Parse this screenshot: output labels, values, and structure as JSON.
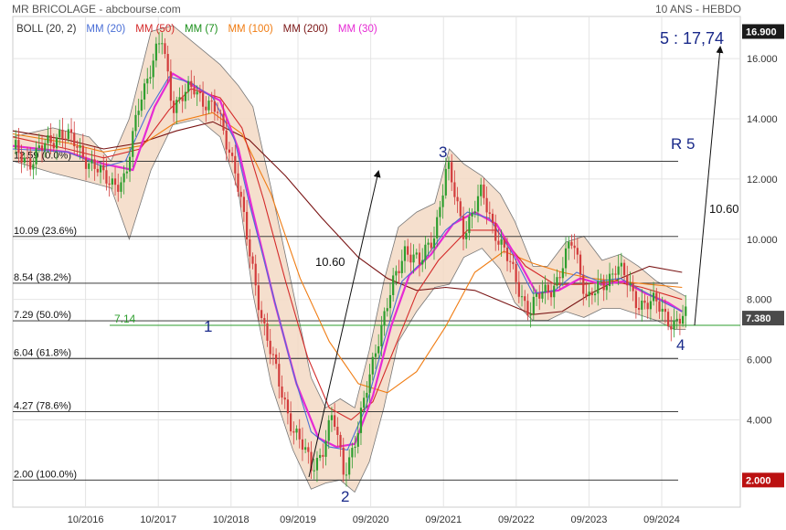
{
  "header": {
    "title": "MR BRICOLAGE - abcbourse.com",
    "timeframe": "10 ANS - HEBDO"
  },
  "legend": [
    {
      "label": "BOLL (20, 2)",
      "color": "#333333"
    },
    {
      "label": "MM (20)",
      "color": "#4a6fd6"
    },
    {
      "label": "MM (50)",
      "color": "#d42a2a"
    },
    {
      "label": "MM (7)",
      "color": "#1a8f1a"
    },
    {
      "label": "MM (100)",
      "color": "#f07c12"
    },
    {
      "label": "MM (200)",
      "color": "#7a1515"
    },
    {
      "label": "MM (30)",
      "color": "#e62ad4"
    }
  ],
  "colors": {
    "up": "#2e9e2e",
    "down": "#d23c3c",
    "band_fill": "#f3d9c4",
    "band_line": "#777777",
    "grid": "#e4e4e4",
    "annotation": "#1a2a8a",
    "hline": "#222222",
    "last_price_bg": "#4a4a4a",
    "target_bg": "#1a1a1a",
    "low_bg": "#bb1111",
    "support": "#2e9e2e"
  },
  "annotations": {
    "target_label": "5 : 17,74",
    "r5": "R 5",
    "measure_left": "10.60",
    "measure_right": "10.60",
    "wave1": "1",
    "wave2": "2",
    "wave3": "3",
    "wave4": "4",
    "support_label": "7.14"
  },
  "price_tags": {
    "target": "16.900",
    "last": "7.380",
    "low": "2.000"
  },
  "chart_data": {
    "type": "candlestick",
    "title": "MR BRICOLAGE - abcbourse.com",
    "subtitle": "10 ANS - HEBDO",
    "x_ticks": [
      {
        "label": "10/2016",
        "t": 2016.75
      },
      {
        "label": "10/2017",
        "t": 2017.75
      },
      {
        "label": "10/2018",
        "t": 2018.75
      },
      {
        "label": "09/2019",
        "t": 2019.67
      },
      {
        "label": "09/2020",
        "t": 2020.67
      },
      {
        "label": "09/2021",
        "t": 2021.67
      },
      {
        "label": "09/2022",
        "t": 2022.67
      },
      {
        "label": "09/2023",
        "t": 2023.67
      },
      {
        "label": "09/2024",
        "t": 2024.67
      }
    ],
    "xlim": [
      2015.75,
      2025.75
    ],
    "y_ticks": [
      4,
      6,
      8,
      10,
      12,
      14,
      16
    ],
    "ylim": [
      1.1,
      17.4
    ],
    "grid": true,
    "fibonacci_levels": [
      {
        "value": 12.59,
        "label": "12.59 (0.0%)"
      },
      {
        "value": 10.09,
        "label": "10.09 (23.6%)"
      },
      {
        "value": 8.54,
        "label": "8.54 (38.2%)"
      },
      {
        "value": 7.29,
        "label": "7.29 (50.0%)"
      },
      {
        "value": 6.04,
        "label": "6.04 (61.8%)"
      },
      {
        "value": 4.27,
        "label": "4.27 (78.6%)"
      },
      {
        "value": 2.0,
        "label": "2.00 (100.0%)"
      }
    ],
    "support_level": 7.14,
    "last_price": 7.38,
    "target_price": 16.9,
    "low_price": 2.0,
    "price_path": [
      [
        2015.75,
        13.0
      ],
      [
        2016.0,
        12.6
      ],
      [
        2016.4,
        13.6
      ],
      [
        2016.7,
        12.9
      ],
      [
        2017.0,
        12.0
      ],
      [
        2017.3,
        11.9
      ],
      [
        2017.5,
        14.8
      ],
      [
        2017.8,
        16.6
      ],
      [
        2017.95,
        14.5
      ],
      [
        2018.25,
        15.0
      ],
      [
        2018.55,
        14.2
      ],
      [
        2018.8,
        12.5
      ],
      [
        2019.0,
        9.5
      ],
      [
        2019.2,
        7.2
      ],
      [
        2019.4,
        5.2
      ],
      [
        2019.6,
        3.8
      ],
      [
        2019.85,
        2.4
      ],
      [
        2020.0,
        3.0
      ],
      [
        2020.15,
        4.1
      ],
      [
        2020.3,
        2.3
      ],
      [
        2020.5,
        3.6
      ],
      [
        2020.75,
        6.6
      ],
      [
        2020.95,
        8.2
      ],
      [
        2021.15,
        9.8
      ],
      [
        2021.35,
        9.1
      ],
      [
        2021.55,
        10.3
      ],
      [
        2021.72,
        12.4
      ],
      [
        2021.95,
        10.3
      ],
      [
        2022.2,
        11.5
      ],
      [
        2022.4,
        10.2
      ],
      [
        2022.6,
        9.0
      ],
      [
        2022.85,
        7.6
      ],
      [
        2023.0,
        8.1
      ],
      [
        2023.25,
        8.7
      ],
      [
        2023.45,
        10.0
      ],
      [
        2023.65,
        8.0
      ],
      [
        2023.85,
        8.4
      ],
      [
        2024.05,
        9.2
      ],
      [
        2024.3,
        8.0
      ],
      [
        2024.6,
        7.8
      ],
      [
        2024.85,
        7.2
      ],
      [
        2025.0,
        7.38
      ]
    ],
    "moving_averages": [
      {
        "name": "MM (20)",
        "color": "#4a6fd6",
        "path": [
          [
            2015.75,
            13.0
          ],
          [
            2016.5,
            12.9
          ],
          [
            2017.0,
            12.4
          ],
          [
            2017.3,
            12.6
          ],
          [
            2017.6,
            14.2
          ],
          [
            2017.9,
            15.4
          ],
          [
            2018.2,
            15.2
          ],
          [
            2018.5,
            14.7
          ],
          [
            2018.8,
            13.3
          ],
          [
            2019.0,
            11.2
          ],
          [
            2019.3,
            8.4
          ],
          [
            2019.6,
            5.6
          ],
          [
            2019.85,
            3.6
          ],
          [
            2020.1,
            3.1
          ],
          [
            2020.35,
            3.0
          ],
          [
            2020.6,
            4.4
          ],
          [
            2020.85,
            6.6
          ],
          [
            2021.1,
            8.6
          ],
          [
            2021.4,
            9.3
          ],
          [
            2021.7,
            10.3
          ],
          [
            2022.0,
            10.9
          ],
          [
            2022.3,
            10.7
          ],
          [
            2022.6,
            9.6
          ],
          [
            2022.9,
            8.2
          ],
          [
            2023.2,
            8.3
          ],
          [
            2023.5,
            8.9
          ],
          [
            2023.8,
            8.6
          ],
          [
            2024.1,
            8.7
          ],
          [
            2024.4,
            8.3
          ],
          [
            2024.7,
            7.9
          ],
          [
            2024.95,
            7.6
          ]
        ]
      },
      {
        "name": "MM (30)",
        "color": "#e62ad4",
        "path": [
          [
            2015.75,
            13.1
          ],
          [
            2016.5,
            12.9
          ],
          [
            2017.0,
            12.5
          ],
          [
            2017.4,
            12.3
          ],
          [
            2017.7,
            14.4
          ],
          [
            2017.95,
            15.5
          ],
          [
            2018.3,
            15.0
          ],
          [
            2018.6,
            14.6
          ],
          [
            2018.85,
            13.0
          ],
          [
            2019.05,
            10.9
          ],
          [
            2019.35,
            7.9
          ],
          [
            2019.65,
            5.2
          ],
          [
            2019.95,
            3.4
          ],
          [
            2020.2,
            3.1
          ],
          [
            2020.45,
            3.2
          ],
          [
            2020.7,
            4.8
          ],
          [
            2020.95,
            7.1
          ],
          [
            2021.2,
            8.8
          ],
          [
            2021.5,
            9.5
          ],
          [
            2021.8,
            10.5
          ],
          [
            2022.1,
            10.9
          ],
          [
            2022.4,
            10.5
          ],
          [
            2022.7,
            9.3
          ],
          [
            2022.95,
            8.2
          ],
          [
            2023.25,
            8.3
          ],
          [
            2023.55,
            8.7
          ],
          [
            2023.85,
            8.5
          ],
          [
            2024.15,
            8.6
          ],
          [
            2024.45,
            8.2
          ],
          [
            2024.75,
            7.9
          ],
          [
            2024.95,
            7.6
          ]
        ]
      },
      {
        "name": "MM (50)",
        "color": "#d42a2a",
        "path": [
          [
            2015.75,
            13.4
          ],
          [
            2016.5,
            13.0
          ],
          [
            2017.0,
            12.7
          ],
          [
            2017.5,
            13.0
          ],
          [
            2017.9,
            14.3
          ],
          [
            2018.2,
            15.0
          ],
          [
            2018.6,
            14.7
          ],
          [
            2018.9,
            13.7
          ],
          [
            2019.2,
            11.3
          ],
          [
            2019.5,
            8.6
          ],
          [
            2019.8,
            6.1
          ],
          [
            2020.1,
            4.4
          ],
          [
            2020.4,
            4.0
          ],
          [
            2020.7,
            4.6
          ],
          [
            2021.0,
            6.4
          ],
          [
            2021.3,
            8.2
          ],
          [
            2021.6,
            9.3
          ],
          [
            2022.0,
            10.3
          ],
          [
            2022.4,
            10.3
          ],
          [
            2022.8,
            9.1
          ],
          [
            2023.2,
            8.5
          ],
          [
            2023.6,
            8.5
          ],
          [
            2024.0,
            8.6
          ],
          [
            2024.4,
            8.4
          ],
          [
            2024.95,
            8.0
          ]
        ]
      },
      {
        "name": "MM (100)",
        "color": "#f07c12",
        "path": [
          [
            2015.75,
            13.5
          ],
          [
            2016.5,
            13.2
          ],
          [
            2017.0,
            12.9
          ],
          [
            2017.5,
            13.1
          ],
          [
            2018.0,
            13.9
          ],
          [
            2018.5,
            14.2
          ],
          [
            2018.9,
            13.5
          ],
          [
            2019.3,
            11.5
          ],
          [
            2019.7,
            8.7
          ],
          [
            2020.1,
            6.6
          ],
          [
            2020.5,
            5.2
          ],
          [
            2020.9,
            4.9
          ],
          [
            2021.3,
            5.6
          ],
          [
            2021.7,
            7.1
          ],
          [
            2022.1,
            8.9
          ],
          [
            2022.5,
            9.6
          ],
          [
            2022.9,
            9.2
          ],
          [
            2023.3,
            8.9
          ],
          [
            2023.7,
            8.7
          ],
          [
            2024.1,
            8.6
          ],
          [
            2024.5,
            8.5
          ],
          [
            2024.95,
            8.4
          ]
        ]
      },
      {
        "name": "MM (200)",
        "color": "#7a1515",
        "path": [
          [
            2015.75,
            13.6
          ],
          [
            2016.5,
            13.3
          ],
          [
            2017.0,
            13.0
          ],
          [
            2017.5,
            13.2
          ],
          [
            2018.0,
            13.6
          ],
          [
            2018.5,
            13.9
          ],
          [
            2019.0,
            13.3
          ],
          [
            2019.5,
            12.1
          ],
          [
            2020.0,
            10.7
          ],
          [
            2020.5,
            9.4
          ],
          [
            2020.9,
            8.7
          ],
          [
            2021.3,
            8.3
          ],
          [
            2021.7,
            8.4
          ],
          [
            2022.1,
            8.3
          ],
          [
            2022.5,
            7.9
          ],
          [
            2022.9,
            7.5
          ],
          [
            2023.3,
            7.6
          ],
          [
            2023.7,
            8.2
          ],
          [
            2024.1,
            8.7
          ],
          [
            2024.5,
            9.1
          ],
          [
            2024.95,
            8.9
          ]
        ]
      }
    ],
    "bollinger_upper": [
      [
        2015.75,
        13.4
      ],
      [
        2016.3,
        13.7
      ],
      [
        2016.8,
        13.4
      ],
      [
        2017.1,
        12.6
      ],
      [
        2017.35,
        14.0
      ],
      [
        2017.65,
        16.9
      ],
      [
        2017.95,
        17.1
      ],
      [
        2018.3,
        16.4
      ],
      [
        2018.6,
        15.8
      ],
      [
        2018.85,
        15.1
      ],
      [
        2019.05,
        14.4
      ],
      [
        2019.3,
        11.7
      ],
      [
        2019.6,
        8.3
      ],
      [
        2019.85,
        5.4
      ],
      [
        2020.05,
        4.4
      ],
      [
        2020.25,
        4.7
      ],
      [
        2020.45,
        4.4
      ],
      [
        2020.65,
        6.3
      ],
      [
        2020.85,
        8.6
      ],
      [
        2021.05,
        10.4
      ],
      [
        2021.3,
        10.9
      ],
      [
        2021.55,
        11.2
      ],
      [
        2021.75,
        13.0
      ],
      [
        2021.95,
        12.5
      ],
      [
        2022.2,
        12.1
      ],
      [
        2022.45,
        11.5
      ],
      [
        2022.65,
        10.6
      ],
      [
        2022.9,
        9.1
      ],
      [
        2023.1,
        9.1
      ],
      [
        2023.35,
        9.9
      ],
      [
        2023.6,
        10.1
      ],
      [
        2023.85,
        9.3
      ],
      [
        2024.1,
        9.5
      ],
      [
        2024.35,
        9.1
      ],
      [
        2024.6,
        8.6
      ],
      [
        2024.85,
        8.3
      ],
      [
        2025.0,
        8.1
      ]
    ],
    "bollinger_lower": [
      [
        2015.75,
        12.6
      ],
      [
        2016.3,
        12.2
      ],
      [
        2016.8,
        11.9
      ],
      [
        2017.1,
        11.7
      ],
      [
        2017.35,
        10.0
      ],
      [
        2017.65,
        12.3
      ],
      [
        2017.95,
        13.8
      ],
      [
        2018.3,
        14.0
      ],
      [
        2018.6,
        13.4
      ],
      [
        2018.85,
        11.6
      ],
      [
        2019.05,
        8.2
      ],
      [
        2019.3,
        5.2
      ],
      [
        2019.6,
        3.0
      ],
      [
        2019.85,
        1.7
      ],
      [
        2020.05,
        1.9
      ],
      [
        2020.25,
        2.0
      ],
      [
        2020.45,
        1.6
      ],
      [
        2020.65,
        2.6
      ],
      [
        2020.85,
        4.4
      ],
      [
        2021.05,
        6.6
      ],
      [
        2021.3,
        7.6
      ],
      [
        2021.55,
        8.4
      ],
      [
        2021.75,
        8.5
      ],
      [
        2021.95,
        9.4
      ],
      [
        2022.2,
        9.7
      ],
      [
        2022.45,
        9.0
      ],
      [
        2022.65,
        7.9
      ],
      [
        2022.9,
        7.3
      ],
      [
        2023.1,
        7.3
      ],
      [
        2023.35,
        7.6
      ],
      [
        2023.6,
        7.4
      ],
      [
        2023.85,
        7.7
      ],
      [
        2024.1,
        7.7
      ],
      [
        2024.35,
        7.5
      ],
      [
        2024.6,
        7.3
      ],
      [
        2024.85,
        7.0
      ],
      [
        2025.0,
        7.0
      ]
    ]
  }
}
